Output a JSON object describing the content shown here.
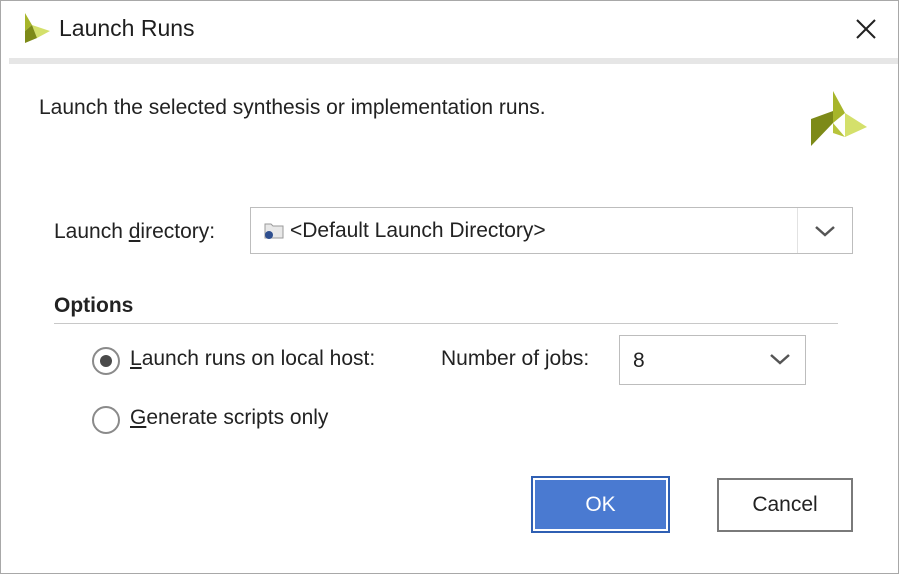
{
  "window": {
    "title": "Launch Runs",
    "logo_icon": "xilinx-logo-icon",
    "close_icon": "close-icon"
  },
  "dialog": {
    "description": "Launch the selected synthesis or implementation runs.",
    "launch_directory": {
      "label_before": "Launch ",
      "label_mnemonic": "d",
      "label_after": "irectory:",
      "value": "<Default Launch Directory>",
      "icon": "folder-icon"
    },
    "options": {
      "title": "Options",
      "local_host": {
        "mnemonic": "L",
        "label_rest": "aunch runs on local host:",
        "selected": true
      },
      "jobs": {
        "label_before": "Number of ",
        "label_mnemonic": "j",
        "label_after": "obs:",
        "value": "8"
      },
      "scripts_only": {
        "mnemonic": "G",
        "label_rest": "enerate scripts only",
        "selected": false
      }
    },
    "buttons": {
      "ok": "OK",
      "cancel": "Cancel"
    }
  },
  "colors": {
    "accent": "#4a7ad1",
    "logo_dark": "#8c9a1d",
    "logo_light": "#d4e06b"
  }
}
